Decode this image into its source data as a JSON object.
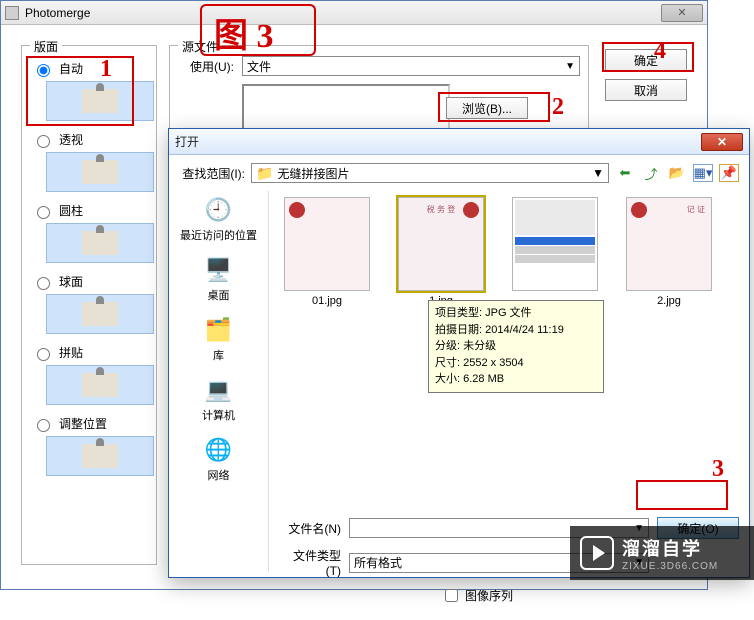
{
  "photomerge": {
    "title": "Photomerge",
    "layout_legend": "版面",
    "options": {
      "auto": "自动",
      "perspective": "透视",
      "cylindrical": "圆柱",
      "spherical": "球面",
      "collage": "拼贴",
      "reposition": "调整位置"
    },
    "source_legend": "源文件",
    "use_label": "使用(U):",
    "use_value": "文件",
    "browse_label": "浏览(B)...",
    "ok_label": "确定",
    "cancel_label": "取消"
  },
  "open": {
    "title": "打开",
    "lookin_label": "查找范围(I):",
    "lookin_value": "无缝拼接图片",
    "places": {
      "recent": "最近访问的位置",
      "desktop": "桌面",
      "library": "库",
      "computer": "计算机",
      "network": "网络"
    },
    "files": [
      {
        "name": "01.jpg"
      },
      {
        "name": "1.jpg"
      },
      {
        "name": "…"
      },
      {
        "name": "2.jpg"
      }
    ],
    "filename_label": "文件名(N)",
    "filename_value": "",
    "filetype_label": "文件类型(T)",
    "filetype_value": "所有格式",
    "open_btn": "确定(O)",
    "image_seq": "图像序列"
  },
  "tooltip": {
    "l1": "项目类型: JPG 文件",
    "l2": "拍摄日期: 2014/4/24 11:19",
    "l3": "分级: 未分级",
    "l4": "尺寸: 2552 x 3504",
    "l5": "大小: 6.28 MB"
  },
  "annotations": {
    "title_box": "图 3",
    "a1": "1",
    "a2": "2",
    "a3": "3",
    "a4": "4"
  },
  "watermark": {
    "line1": "溜溜自学",
    "line2": "ZIXUE.3D66.COM"
  }
}
